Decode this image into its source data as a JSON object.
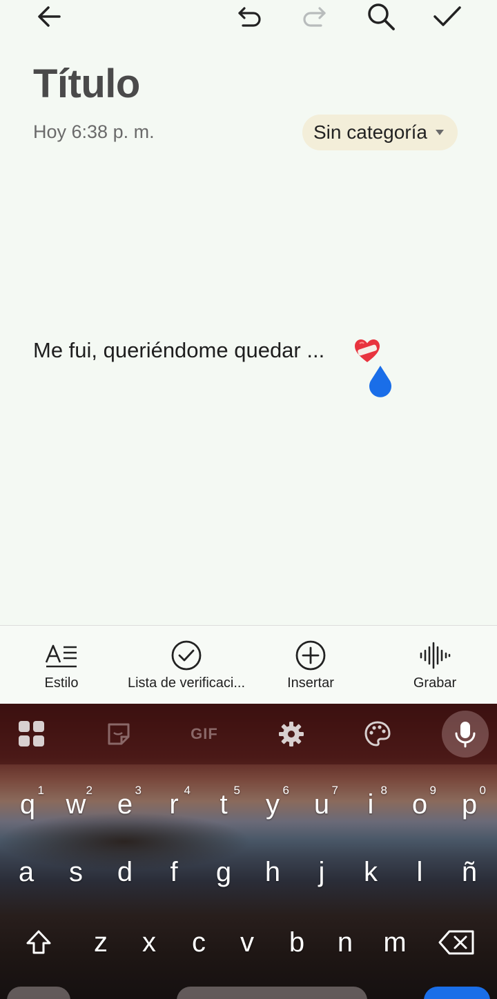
{
  "note": {
    "title": "Título",
    "date": "Hoy 6:38 p. m.",
    "category": "Sin categoría",
    "body": "Me fui, queriéndome quedar ..."
  },
  "toolbar": {
    "style_label": "Estilo",
    "checklist_label": "Lista de verificaci...",
    "insert_label": "Insertar",
    "record_label": "Grabar"
  },
  "keyboard": {
    "gif_label": "GIF",
    "row1": [
      {
        "key": "q",
        "sup": "1"
      },
      {
        "key": "w",
        "sup": "2"
      },
      {
        "key": "e",
        "sup": "3"
      },
      {
        "key": "r",
        "sup": "4"
      },
      {
        "key": "t",
        "sup": "5"
      },
      {
        "key": "y",
        "sup": "6"
      },
      {
        "key": "u",
        "sup": "7"
      },
      {
        "key": "i",
        "sup": "8"
      },
      {
        "key": "o",
        "sup": "9"
      },
      {
        "key": "p",
        "sup": "0"
      }
    ],
    "row2": [
      "a",
      "s",
      "d",
      "f",
      "g",
      "h",
      "j",
      "k",
      "l",
      "ñ"
    ],
    "row3": [
      "z",
      "x",
      "c",
      "v",
      "b",
      "n",
      "m"
    ]
  },
  "colors": {
    "background": "#f4f9f3",
    "category_chip": "#f3eed9",
    "cursor_handle": "#1a6ee8",
    "heart": "#e8343e"
  }
}
